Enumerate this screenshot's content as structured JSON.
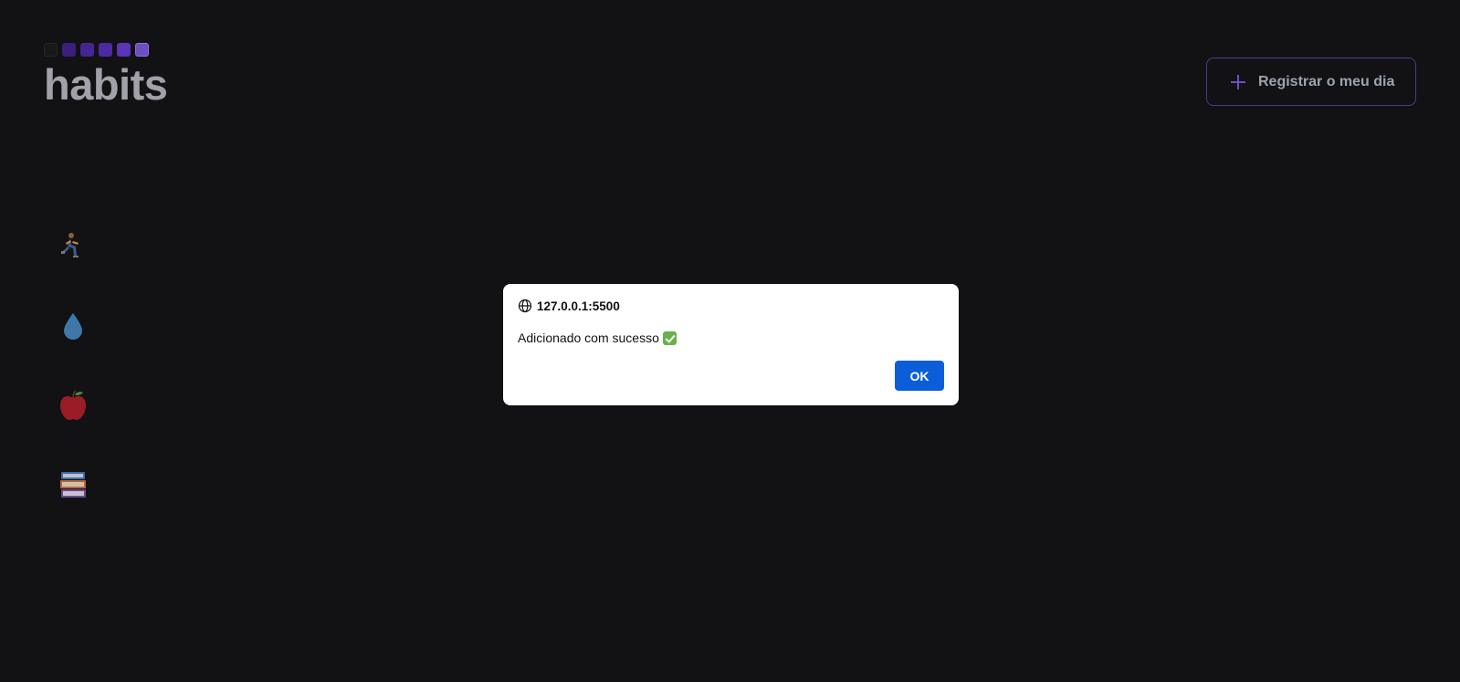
{
  "header": {
    "logo_text": "habits",
    "logo_squares": [
      "#18181b",
      "#3b1f7a",
      "#452594",
      "#4c2aa3",
      "#5b35b8",
      "#6d4fc2"
    ],
    "register_button_label": "Registrar o meu dia",
    "accent_color": "#6d4fc2"
  },
  "habits": [
    {
      "icon": "running-person-icon"
    },
    {
      "icon": "water-drop-icon"
    },
    {
      "icon": "apple-icon"
    },
    {
      "icon": "books-icon"
    }
  ],
  "dialog": {
    "origin": "127.0.0.1:5500",
    "message": "Adicionado com sucesso",
    "message_icon": "check-mark-button-icon",
    "ok_label": "OK",
    "ok_color": "#0b5ed7"
  }
}
